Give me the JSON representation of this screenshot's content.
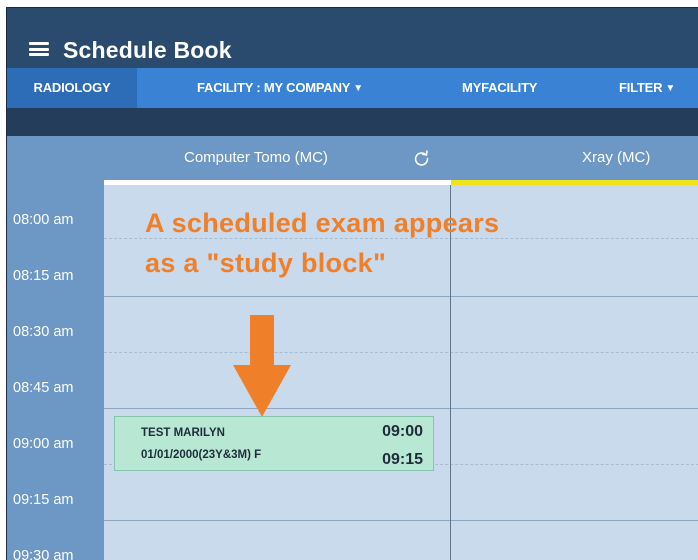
{
  "app": {
    "title": "Schedule Book"
  },
  "nav": {
    "items": [
      {
        "label": "RADIOLOGY",
        "active": true
      },
      {
        "label": "FACILITY : MY COMPANY",
        "dropdown": true
      },
      {
        "label": "MYFACILITY"
      },
      {
        "label": "FILTER",
        "dropdown": true
      }
    ]
  },
  "columns": [
    {
      "name": "Computer Tomo (MC)"
    },
    {
      "name": "Xray (MC)"
    }
  ],
  "times": [
    "08:00 am",
    "08:15 am",
    "08:30 am",
    "08:45 am",
    "09:00 am",
    "09:15 am",
    "09:30 am"
  ],
  "annotation": {
    "line1": "A scheduled exam appears",
    "line2": "as a \"study block\""
  },
  "study_block": {
    "patient_name": "TEST MARILYN",
    "dob_info": "01/01/2000(23Y&3M) F",
    "start": "09:00",
    "end": "09:15"
  },
  "colors": {
    "header": "#2a4a6e",
    "nav": "#3a83d4",
    "nav_active": "#2d6cb7",
    "column_header": "#6d97c4",
    "grid": "#c9daec",
    "study_block": "#b8e7d4",
    "annotation": "#f07f2a",
    "selected_column_marker": "#ede31e"
  },
  "icons": [
    "menu-icon",
    "refresh-icon",
    "caret-down-icon",
    "arrow-down-icon"
  ]
}
